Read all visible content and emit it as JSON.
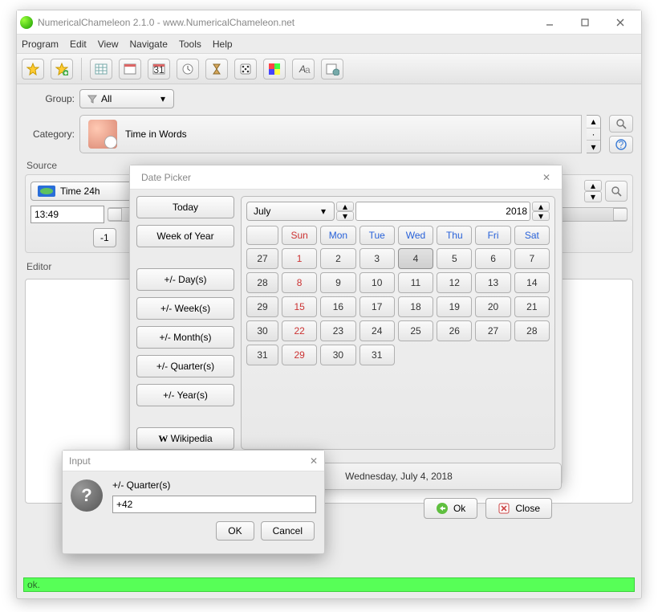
{
  "titlebar": {
    "title": "NumericalChameleon 2.1.0 - www.NumericalChameleon.net"
  },
  "menu": {
    "items": [
      "Program",
      "Edit",
      "View",
      "Navigate",
      "Tools",
      "Help"
    ]
  },
  "toolbar_icons": [
    "star-icon",
    "star-add-icon",
    "grid-icon",
    "calendar-grid-icon",
    "calendar-day-icon",
    "clock-icon",
    "hourglass-icon",
    "dice-icon",
    "color-swatch-icon",
    "text-tool-icon",
    "template-icon"
  ],
  "group": {
    "label": "Group:",
    "value": "All"
  },
  "category": {
    "label": "Category:",
    "value": "Time in Words"
  },
  "source": {
    "label": "Source",
    "selector": "Time 24h",
    "value": "13:49",
    "neg1": "-1"
  },
  "editor": {
    "label": "Editor"
  },
  "status": "ok.",
  "datepicker": {
    "title": "Date Picker",
    "left_buttons_top": [
      "Today",
      "Week of Year"
    ],
    "left_buttons_mid": [
      "+/- Day(s)",
      "+/- Week(s)",
      "+/- Month(s)",
      "+/- Quarter(s)",
      "+/- Year(s)"
    ],
    "left_button_bottom": "Wikipedia",
    "month": "July",
    "year": "2018",
    "day_headers": [
      "Sun",
      "Mon",
      "Tue",
      "Wed",
      "Thu",
      "Fri",
      "Sat"
    ],
    "weeks": [
      "27",
      "28",
      "29",
      "30",
      "31"
    ],
    "grid": [
      [
        "1",
        "2",
        "3",
        "4",
        "5",
        "6",
        "7"
      ],
      [
        "8",
        "9",
        "10",
        "11",
        "12",
        "13",
        "14"
      ],
      [
        "15",
        "16",
        "17",
        "18",
        "19",
        "20",
        "21"
      ],
      [
        "22",
        "23",
        "24",
        "25",
        "26",
        "27",
        "28"
      ],
      [
        "29",
        "30",
        "31",
        "",
        "",
        "",
        ""
      ]
    ],
    "selected_day": "4",
    "long_date": "Wednesday, July 4, 2018",
    "ok": "Ok",
    "close": "Close"
  },
  "input_dialog": {
    "title": "Input",
    "prompt": "+/- Quarter(s)",
    "value": "+42",
    "ok": "OK",
    "cancel": "Cancel"
  }
}
